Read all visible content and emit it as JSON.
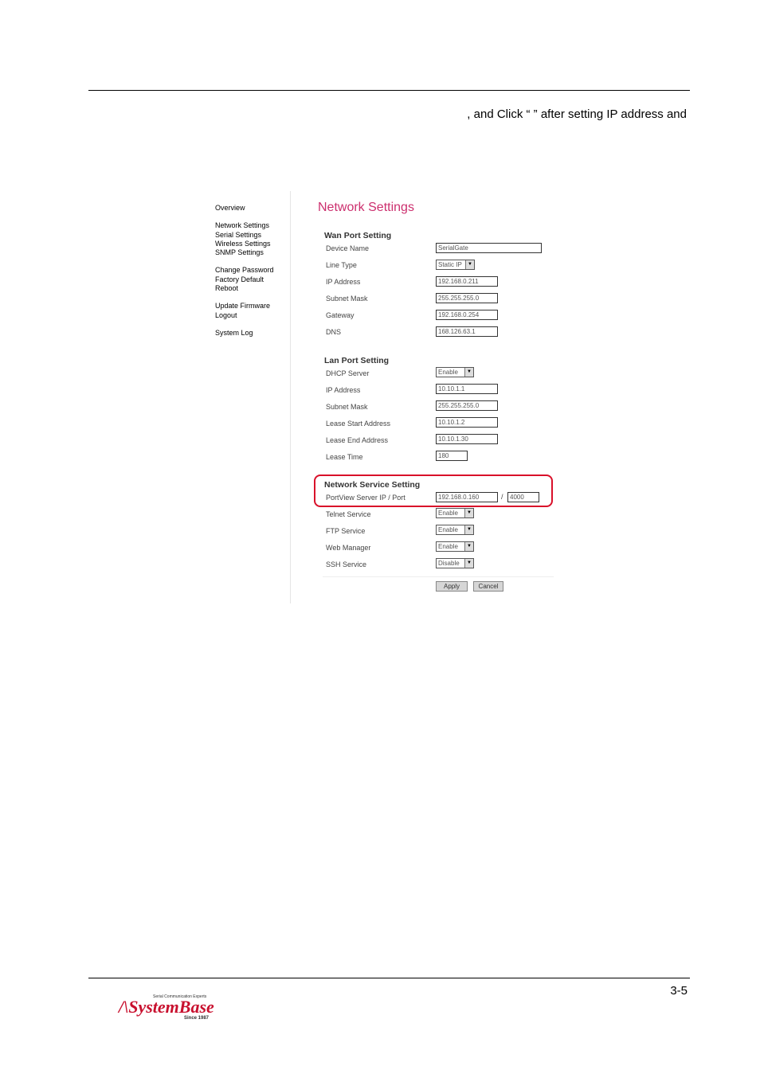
{
  "intro_text": ", and Click “        ” after setting IP address and",
  "sidebar": {
    "groups": [
      [
        "Overview"
      ],
      [
        "Network Settings",
        "Serial Settings",
        "Wireless Settings",
        "SNMP Settings"
      ],
      [
        "Change Password",
        "Factory Default",
        "Reboot"
      ],
      [
        "Update Firmware",
        "Logout"
      ],
      [
        "System Log"
      ]
    ]
  },
  "page_title": "Network Settings",
  "wan": {
    "heading": "Wan Port Setting",
    "device_name_label": "Device Name",
    "device_name": "SerialGate",
    "line_type_label": "Line Type",
    "line_type": "Static IP",
    "ip_label": "IP Address",
    "ip": "192.168.0.211",
    "subnet_label": "Subnet Mask",
    "subnet": "255.255.255.0",
    "gateway_label": "Gateway",
    "gateway": "192.168.0.254",
    "dns_label": "DNS",
    "dns": "168.126.63.1"
  },
  "lan": {
    "heading": "Lan Port Setting",
    "dhcp_label": "DHCP Server",
    "dhcp": "Enable",
    "ip_label": "IP Address",
    "ip": "10.10.1.1",
    "subnet_label": "Subnet Mask",
    "subnet": "255.255.255.0",
    "lease_start_label": "Lease Start Address",
    "lease_start": "10.10.1.2",
    "lease_end_label": "Lease End Address",
    "lease_end": "10.10.1.30",
    "lease_time_label": "Lease Time",
    "lease_time": "180"
  },
  "service": {
    "heading": "Network Service Setting",
    "portview_label": "PortView Server IP / Port",
    "portview_ip": "192.168.0.160",
    "portview_sep": "/",
    "portview_port": "4000",
    "telnet_label": "Telnet Service",
    "telnet": "Enable",
    "ftp_label": "FTP Service",
    "ftp": "Enable",
    "web_label": "Web Manager",
    "web": "Enable",
    "ssh_label": "SSH Service",
    "ssh": "Disable"
  },
  "buttons": {
    "apply": "Apply",
    "cancel": "Cancel"
  },
  "page_number": "3-5",
  "logo": {
    "tagline": "Serial Communication Experts",
    "name": "SystemBase",
    "since": "Since 1987",
    "color": "#c8102e"
  },
  "colors": {
    "title": "#cc2f6e",
    "highlight": "#d9102a"
  }
}
